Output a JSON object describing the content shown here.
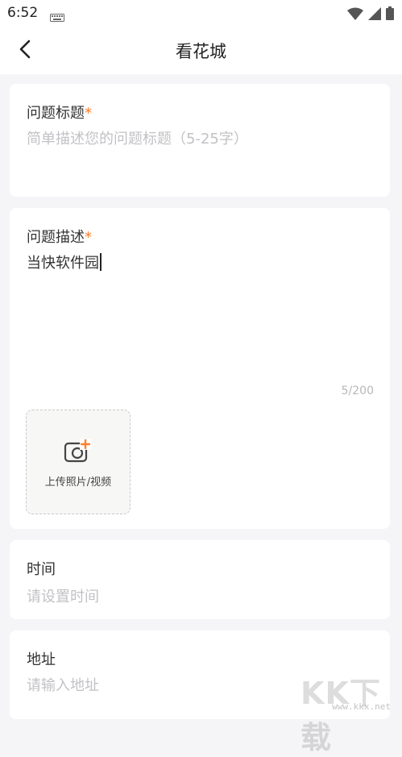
{
  "status_bar": {
    "time": "6:52",
    "icons": [
      "keyboard-icon",
      "wifi-icon",
      "signal-icon",
      "battery-icon"
    ]
  },
  "nav": {
    "back_icon": "chevron-left-icon",
    "title": "看花城"
  },
  "title_field": {
    "label": "问题标题",
    "required_mark": "*",
    "placeholder": "简单描述您的问题标题（5-25字）",
    "value": ""
  },
  "description_field": {
    "label": "问题描述",
    "required_mark": "*",
    "value": "当快软件园",
    "counter": "5/200"
  },
  "upload": {
    "icon": "camera-add-icon",
    "label": "上传照片/视频"
  },
  "time_field": {
    "label": "时间",
    "placeholder": "请设置时间"
  },
  "address_field": {
    "label": "地址",
    "placeholder": "请输入地址"
  },
  "watermark": {
    "logo": "KK下载",
    "url": "www.kkx.net"
  },
  "colors": {
    "accent": "#ff7d2a",
    "background": "#f5f5f8",
    "placeholder": "#c2c2c6"
  }
}
